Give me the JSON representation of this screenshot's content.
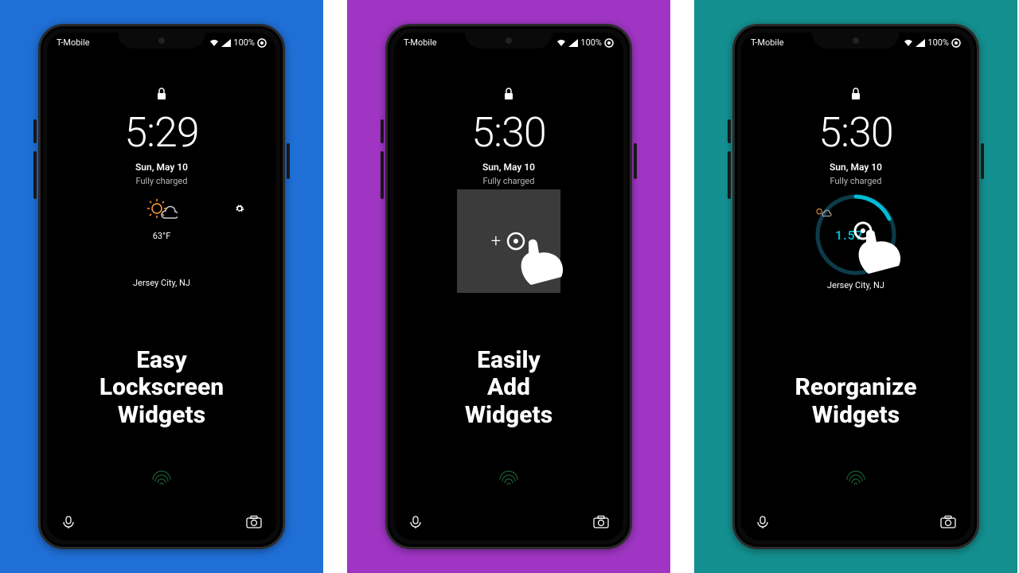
{
  "panels": [
    {
      "bg": "blue",
      "status": {
        "carrier": "T-Mobile",
        "battery": "100%"
      },
      "lockscreen": {
        "time": "5:29",
        "date": "Sun, May 10",
        "battery_status": "Fully charged",
        "temperature": "63°F",
        "location": "Jersey City, NJ"
      },
      "tagline": "Easy\nLockscreen\nWidgets"
    },
    {
      "bg": "purple",
      "status": {
        "carrier": "T-Mobile",
        "battery": "100%"
      },
      "lockscreen": {
        "time": "5:30",
        "date": "Sun, May 10",
        "battery_status": "Fully charged"
      },
      "add_widget": {
        "plus": "+"
      },
      "tagline": "Easily\nAdd\nWidgets"
    },
    {
      "bg": "teal",
      "status": {
        "carrier": "T-Mobile",
        "battery": "100%"
      },
      "lockscreen": {
        "time": "5:30",
        "date": "Sun, May 10",
        "battery_status": "Fully charged",
        "location": "Jersey City, NJ"
      },
      "circular_widget": {
        "center_text": "1.57 B"
      },
      "tagline": "Reorganize\nWidgets"
    }
  ]
}
